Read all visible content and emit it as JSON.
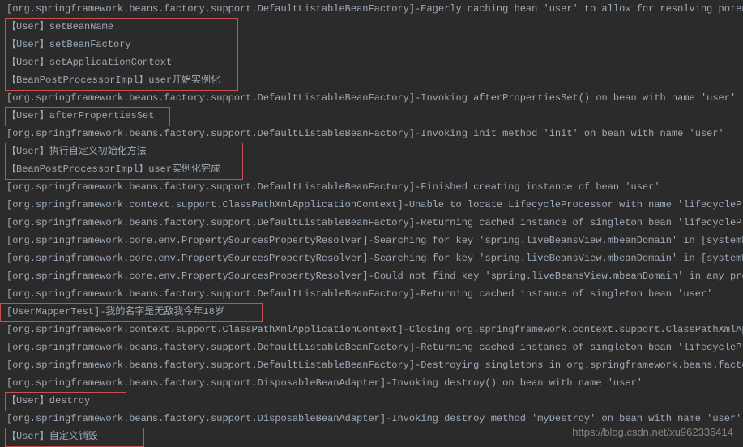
{
  "lines": [
    "[org.springframework.beans.factory.support.DefaultListableBeanFactory]-Eagerly caching bean 'user' to allow for resolving potenti",
    "【User】setBeanName",
    "【User】setBeanFactory",
    "【User】setApplicationContext",
    "【BeanPostProcessorImpl】user开始实例化",
    "[org.springframework.beans.factory.support.DefaultListableBeanFactory]-Invoking afterPropertiesSet() on bean with name 'user'",
    "【User】afterPropertiesSet",
    "[org.springframework.beans.factory.support.DefaultListableBeanFactory]-Invoking init method  'init' on bean with name 'user'",
    "【User】执行自定义初始化方法",
    "【BeanPostProcessorImpl】user实例化完成",
    "[org.springframework.beans.factory.support.DefaultListableBeanFactory]-Finished creating instance of bean 'user'",
    "[org.springframework.context.support.ClassPathXmlApplicationContext]-Unable to locate LifecycleProcessor with name 'lifecycleProc",
    "[org.springframework.beans.factory.support.DefaultListableBeanFactory]-Returning cached instance of singleton bean 'lifecycleProc",
    "[org.springframework.core.env.PropertySourcesPropertyResolver]-Searching for key 'spring.liveBeansView.mbeanDomain' in [systemPro",
    "[org.springframework.core.env.PropertySourcesPropertyResolver]-Searching for key 'spring.liveBeansView.mbeanDomain' in [systemEnv",
    "[org.springframework.core.env.PropertySourcesPropertyResolver]-Could not find key 'spring.liveBeansView.mbeanDomain' in any prope",
    "[org.springframework.beans.factory.support.DefaultListableBeanFactory]-Returning cached instance of singleton bean 'user'",
    "[UserMapperTest]-我的名字是无敌我今年18岁",
    "[org.springframework.context.support.ClassPathXmlApplicationContext]-Closing org.springframework.context.support.ClassPathXmlAppl",
    "[org.springframework.beans.factory.support.DefaultListableBeanFactory]-Returning cached instance of singleton bean 'lifecycleProc",
    "[org.springframework.beans.factory.support.DefaultListableBeanFactory]-Destroying singletons in org.springframework.beans.factory",
    "[org.springframework.beans.factory.support.DisposableBeanAdapter]-Invoking destroy() on bean with name 'user'",
    "【User】destroy",
    "[org.springframework.beans.factory.support.DisposableBeanAdapter]-Invoking destroy method 'myDestroy' on bean with name 'user'",
    "【User】自定义销毁"
  ],
  "watermark": "https://blog.csdn.net/xu962336414"
}
